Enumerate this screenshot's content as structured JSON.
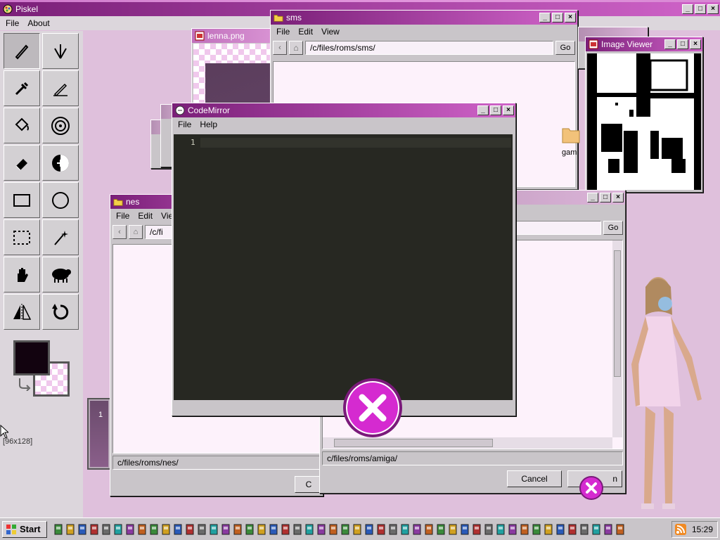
{
  "piskel": {
    "title": "Piskel",
    "menu": [
      "File",
      "About"
    ],
    "size_label": "[96x128]",
    "frame_number": "1",
    "tools": [
      "pen-icon",
      "vertical-mirror-pen-icon",
      "pipette-icon",
      "stroke-icon",
      "paint-bucket-icon",
      "spray-icon",
      "eraser-icon",
      "lighten-icon",
      "rectangle-icon",
      "circle-icon",
      "rect-select-icon",
      "magic-wand-icon",
      "hand-icon",
      "shape-select-icon",
      "flip-icon",
      "rotate-icon"
    ]
  },
  "sms_window": {
    "title": "sms",
    "menu": [
      "File",
      "Edit",
      "View"
    ],
    "path": "/c/files/roms/sms/",
    "go": "Go",
    "folder_label": "gam"
  },
  "lenna_window": {
    "title": "lenna.png"
  },
  "image_viewer": {
    "title": "Image Viewer"
  },
  "codemirror": {
    "title": "CodeMirror",
    "menu": [
      "File",
      "Help"
    ],
    "line_number": "1"
  },
  "nes_window": {
    "title": "nes",
    "menu": [
      "File",
      "Edit",
      "View"
    ],
    "path": "/c/fi",
    "status": "c/files/roms/nes/",
    "cancel_partial": "C"
  },
  "amiga_window": {
    "go": "Go",
    "status": "c/files/roms/amiga/",
    "cancel": "Cancel",
    "ok_partial": "n"
  },
  "taskbar": {
    "start": "Start",
    "clock": "15:29",
    "icon_count": 48
  },
  "colors": {
    "accent": "#d52ad0",
    "title_active": "#7a1f78",
    "editor_bg": "#272822"
  }
}
